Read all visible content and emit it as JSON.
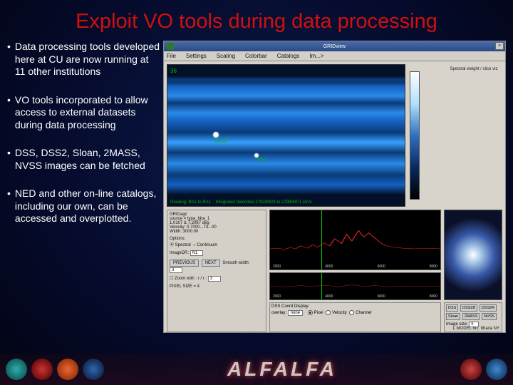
{
  "title": "Exploit VO tools during data processing",
  "bullets": [
    "Data processing tools developed here at CU are now running at 11 other institutions",
    "VO tools incorporated to allow access to external datasets during data processing",
    "DSS, DSS2, Sloan, 2MASS, NVSS images can be fetched",
    "NED and other on-line catalogs, including our own, can be accessed and overplotted."
  ],
  "app": {
    "window_title": "GRIDview",
    "close_symbol": "×",
    "menus": [
      "File",
      "Settings",
      "Scaling",
      "Colorbar",
      "Catalogs",
      "Im...>"
    ],
    "sky": {
      "corner_num": "36",
      "label1": "U438",
      "label2": "H52",
      "caption_left": "Drawing: RA1 to RA1",
      "caption_mid": "Integrated Velocities  2782/8923  to  2798/8971 km/s"
    },
    "right_caption": "Spectral weight / slice viz",
    "info": {
      "h_source": "GRIDagc",
      "h_line2": "source = typa_bba_1",
      "h_line3": "1.0107 & 7.2067 deg",
      "h_line4": "Velocity: 0.7000...73...00",
      "h_line5": "Width:   3000.00",
      "opt_header": "Options:",
      "opt1": "Spectral",
      "opt2": "Continuum",
      "imsrc_label": "ImageDR:",
      "imsrc_value": "N1",
      "btn_prev": "PREVIOUS",
      "btn_next": "NEXT",
      "label_smooth": "Smooth width:",
      "smooth_val": "3",
      "chk_zoom": "Zoom with  : r / r :",
      "zoom_val": "3",
      "status": "PIXEL SIZE  =  4"
    },
    "plot_axis": [
      "2000",
      "4000",
      "6000",
      "8000"
    ],
    "plot_controls": {
      "title": "DSS Coord Display:",
      "ovl_label": "overlay:",
      "ovl_value": "none",
      "r_pixel": "Pixel",
      "r_vel": "Velocity",
      "r_chan": "Channel"
    },
    "dss": {
      "btn_dss": "DSS",
      "btn_dss2b": "DSS2B",
      "btn_dss2r": "DSS2R",
      "btn_sloan": "Sloan",
      "btn_2mass": "2MASS",
      "btn_nvss": "NVSS",
      "size_label": "Image size:",
      "size_val": "5"
    },
    "credit": "L MODEL Inc.  Ithaca NY"
  },
  "footer_brand": "ALFALFA"
}
